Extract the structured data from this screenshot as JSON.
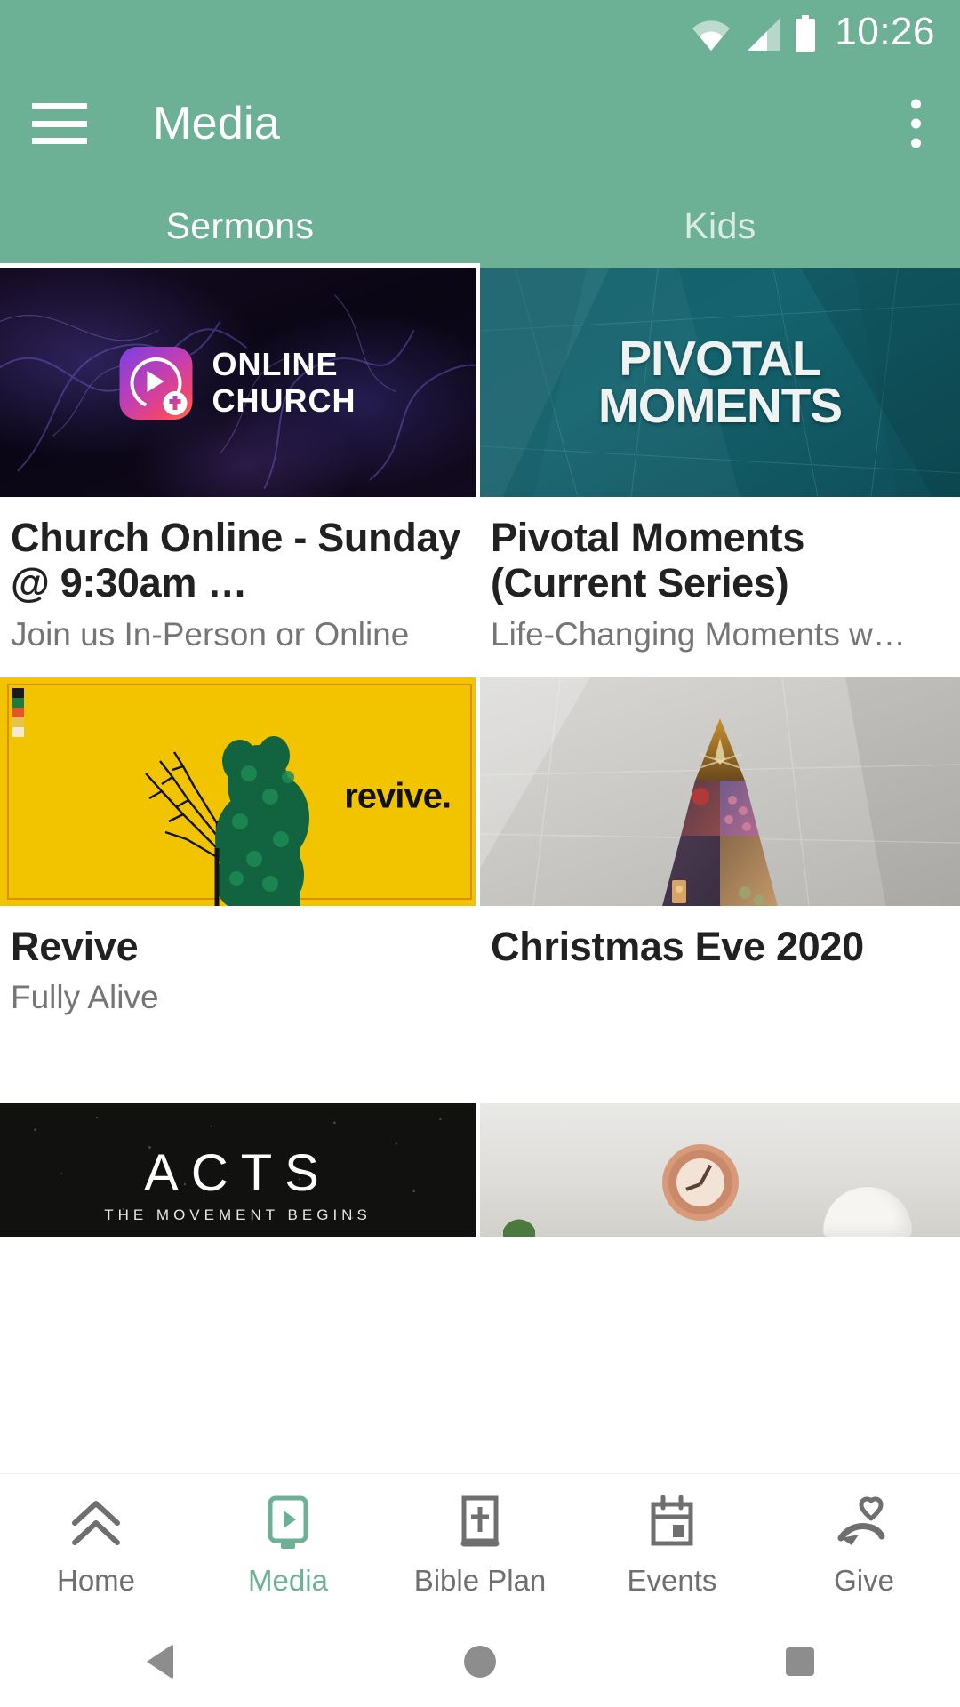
{
  "status_bar": {
    "time": "10:26",
    "icons": [
      "wifi-icon",
      "cellular-signal-icon",
      "battery-icon"
    ]
  },
  "app_bar": {
    "title": "Media",
    "menu_icon": "hamburger-menu-icon",
    "overflow_icon": "kebab-menu-icon"
  },
  "tabs": {
    "active_index": 0,
    "items": [
      {
        "label": "Sermons"
      },
      {
        "label": "Kids"
      }
    ]
  },
  "media_grid": {
    "items": [
      {
        "title": "Church Online - Sunday @ 9:30am …",
        "subtitle": "Join us In-Person or Online",
        "thumb_kind": "online-church",
        "thumb_text_primary": "ONLINE",
        "thumb_text_secondary": "CHURCH",
        "thumb_bg": "#0a0614"
      },
      {
        "title": "Pivotal Moments (Current Series)",
        "subtitle": "Life-Changing Moments w…",
        "thumb_kind": "pivotal-moments",
        "thumb_text_primary": "PIVOTAL",
        "thumb_text_secondary": "MOMENTS",
        "thumb_bg": "#13616b"
      },
      {
        "title": "Revive",
        "subtitle": "Fully Alive",
        "thumb_kind": "revive",
        "thumb_text_primary": "revive.",
        "thumb_bg": "#f2c400"
      },
      {
        "title": "Christmas Eve 2020",
        "subtitle": "",
        "thumb_kind": "christmas-tree",
        "thumb_bg": "#c9c8c4"
      },
      {
        "title": "",
        "subtitle": "",
        "thumb_kind": "acts",
        "thumb_text_primary": "ACTS",
        "thumb_text_secondary": "THE MOVEMENT BEGINS",
        "thumb_bg": "#111110"
      },
      {
        "title": "",
        "subtitle": "",
        "thumb_kind": "clock-room",
        "thumb_bg": "#dedcd8"
      }
    ]
  },
  "bottom_nav": {
    "active_index": 1,
    "items": [
      {
        "label": "Home",
        "icon": "double-chevron-up-icon"
      },
      {
        "label": "Media",
        "icon": "tablet-play-icon"
      },
      {
        "label": "Bible Plan",
        "icon": "bible-book-cross-icon"
      },
      {
        "label": "Events",
        "icon": "calendar-icon"
      },
      {
        "label": "Give",
        "icon": "hand-heart-icon"
      }
    ]
  },
  "android_nav": {
    "items": [
      {
        "name": "back",
        "icon": "triangle-back-icon"
      },
      {
        "name": "home",
        "icon": "circle-home-icon"
      },
      {
        "name": "recents",
        "icon": "square-recents-icon"
      }
    ]
  },
  "colors": {
    "brand_green": "#6cb095",
    "accent_green": "#6cb095",
    "title_text": "#212121",
    "subtitle_text": "#757575",
    "nav_inactive": "#6f6f6f"
  }
}
